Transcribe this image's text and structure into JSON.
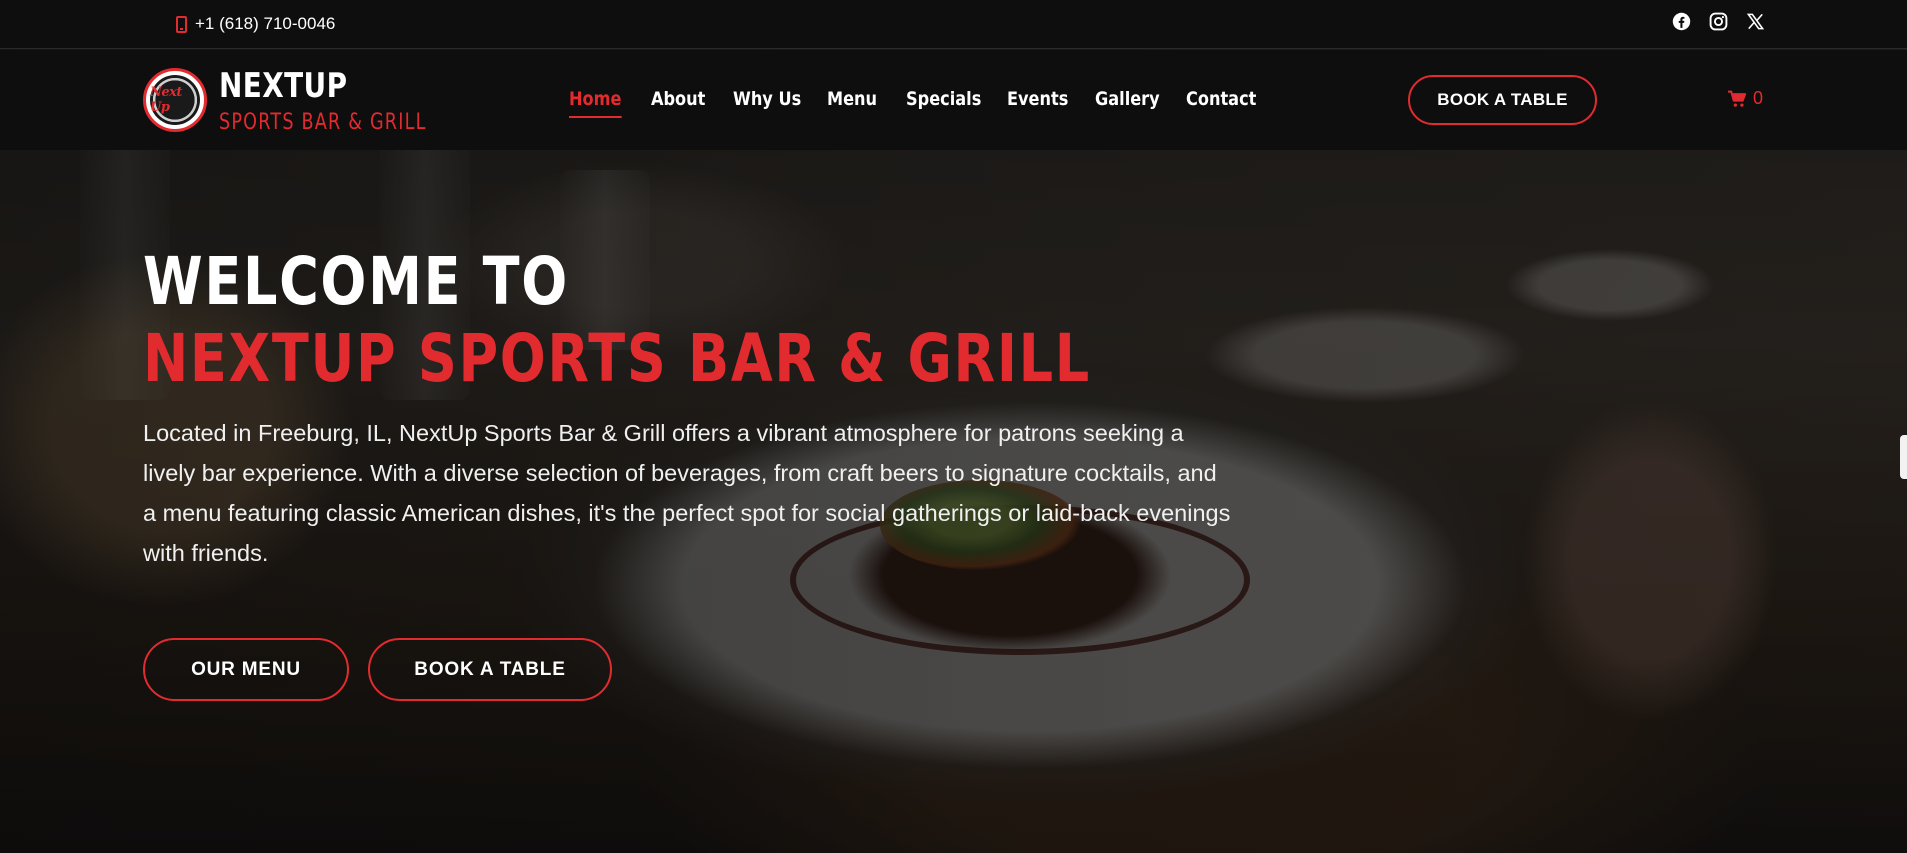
{
  "topbar": {
    "phone": "+1 (618) 710-0046",
    "socials": [
      "facebook-icon",
      "instagram-icon",
      "x-icon"
    ]
  },
  "brand": {
    "logo_text": "Next Up",
    "name": "NEXTUP",
    "subtitle": "SPORTS BAR & GRILL"
  },
  "nav": {
    "items": [
      {
        "label": "Home",
        "active": true
      },
      {
        "label": "About"
      },
      {
        "label": "Why Us"
      },
      {
        "label": "Menu"
      },
      {
        "label": "Specials"
      },
      {
        "label": "Events"
      },
      {
        "label": "Gallery"
      },
      {
        "label": "Contact"
      }
    ],
    "book_label": "BOOK A TABLE",
    "cart_count": "0"
  },
  "hero": {
    "title_line1": "WELCOME TO",
    "title_line2": "NEXTUP SPORTS BAR & GRILL",
    "description": "Located in Freeburg, IL, NextUp Sports Bar & Grill offers a vibrant atmosphere for patrons seeking a lively bar experience. With a diverse selection of beverages, from craft beers to signature cocktails, and a menu featuring classic American dishes, it's the perfect spot for social gatherings or laid-back evenings with friends.",
    "btn_menu": "OUR MENU",
    "btn_book": "BOOK A TABLE"
  },
  "colors": {
    "accent": "#e22b2f",
    "background": "#0e0e0e",
    "text": "#ffffff"
  }
}
